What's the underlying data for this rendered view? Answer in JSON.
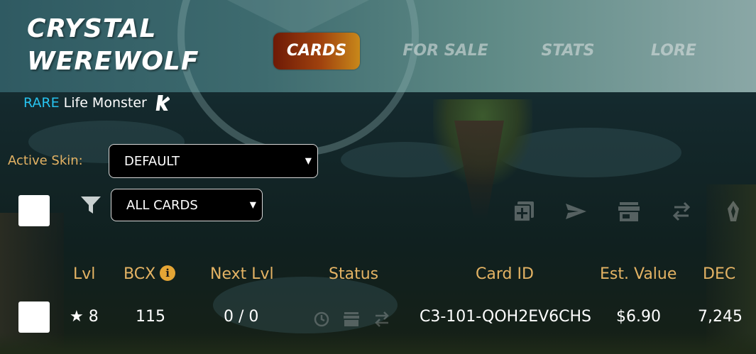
{
  "card": {
    "title_line1": "CRYSTAL",
    "title_line2": "WEREWOLF",
    "rarity": "RARE",
    "type": "Life Monster",
    "edition_icon": "untamed-edition-icon"
  },
  "tabs": [
    {
      "label": "CARDS",
      "active": true
    },
    {
      "label": "FOR SALE",
      "active": false
    },
    {
      "label": "STATS",
      "active": false
    },
    {
      "label": "LORE",
      "active": false
    }
  ],
  "skin": {
    "label": "Active Skin:",
    "selected": "DEFAULT"
  },
  "filter": {
    "icon": "filter-icon",
    "selected": "ALL CARDS"
  },
  "actions": [
    "combine-icon",
    "send-icon",
    "market-icon",
    "transfer-icon",
    "burn-icon"
  ],
  "table": {
    "headers": {
      "lvl": "Lvl",
      "bcx": "BCX",
      "next_lvl": "Next Lvl",
      "status": "Status",
      "card_id": "Card ID",
      "est_value": "Est. Value",
      "dec": "DEC"
    },
    "rows": [
      {
        "lvl": "★ 8",
        "bcx": "115",
        "next_lvl": "0 / 0",
        "status_icons": [
          "clock-icon",
          "market-icon",
          "transfer-icon"
        ],
        "card_id": "C3-101-QOH2EV6CHS",
        "est_value": "$6.90",
        "dec": "7,245"
      }
    ]
  },
  "colors": {
    "accent_gold": "#e4b364",
    "rarity_blue": "#27c2ee",
    "tab_active_start": "#6e1a06",
    "tab_active_end": "#c8881a"
  }
}
